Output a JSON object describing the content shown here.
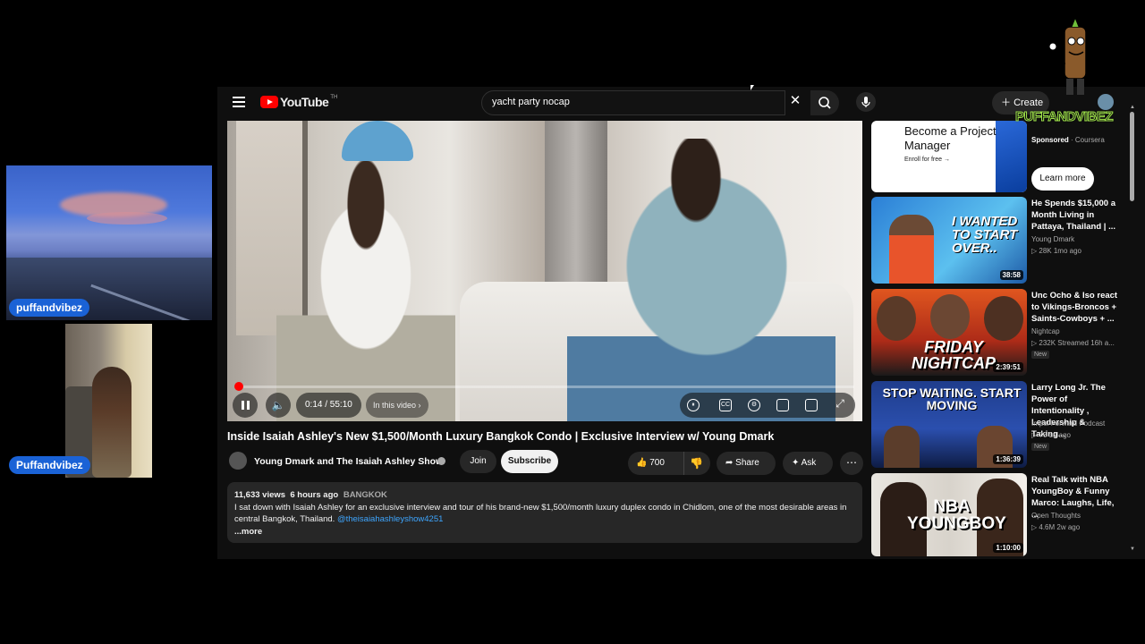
{
  "overlay": {
    "user_top": "puffandvibez",
    "user_bottom": "Puffandvibez",
    "watermark": "PUFFANDVIBEZ"
  },
  "youtube": {
    "logo": "YouTube",
    "logo_country": "TH",
    "search_value": "yacht party nocap",
    "create_label": "Create",
    "player": {
      "time": "0:14 / 55:10",
      "chapters": "In this video",
      "progress": 0.004
    },
    "video": {
      "title": "Inside Isaiah Ashley's New $1,500/Month Luxury Bangkok Condo | Exclusive Interview w/ Young Dmark",
      "channel": "Young Dmark and The Isaiah Ashley Show",
      "join": "Join",
      "subscribe": "Subscribe",
      "likes": "700",
      "share": "Share",
      "ask": "Ask"
    },
    "description": {
      "views": "11,633 views",
      "age": "6 hours ago",
      "location": "BANGKOK",
      "text": "I sat down with Isaiah Ashley for an exclusive interview and tour of his brand-new $1,500/month luxury duplex condo in Chidlom, one of the most desirable areas in central Bangkok, Thailand.",
      "link": "@theisaiahashleyshow4251",
      "more": "...more"
    },
    "ad": {
      "headline": "Become a Project Manager",
      "cta_small": "Enroll for free →",
      "sponsored": "Sponsored",
      "advertiser": "Coursera",
      "learn_more": "Learn more"
    },
    "recommendations": [
      {
        "title": "He Spends $15,000 a Month Living in Pattaya, Thailand | ...",
        "channel": "Young Dmark",
        "meta": "▷ 28K  1mo ago",
        "duration": "38:58",
        "thumb_text": "I WANTED TO START OVER..",
        "badge": ""
      },
      {
        "title": "Unc Ocho & Iso react to Vikings-Broncos + Saints-Cowboys + ...",
        "channel": "Nightcap",
        "meta": "▷ 232K  Streamed 16h a...",
        "duration": "2:39:51",
        "thumb_text": "FRIDAY NIGHTCAP",
        "badge": "New"
      },
      {
        "title": "Larry Long Jr. The Power of Intentionality , Leadership & Taking...",
        "channel": "Impel Forward Podcast",
        "meta": "▷ 76  1d ago",
        "duration": "1:36:39",
        "thumb_text": "STOP WAITING. START MOVING",
        "badge": "New"
      },
      {
        "title": "Real Talk with NBA YoungBoy & Funny Marco: Laughs, Life, ...",
        "channel": "Open Thoughts",
        "meta": "▷ 4.6M  2w ago",
        "duration": "1:10:00",
        "thumb_text": "NBA YOUNGBOY",
        "badge": ""
      }
    ]
  }
}
